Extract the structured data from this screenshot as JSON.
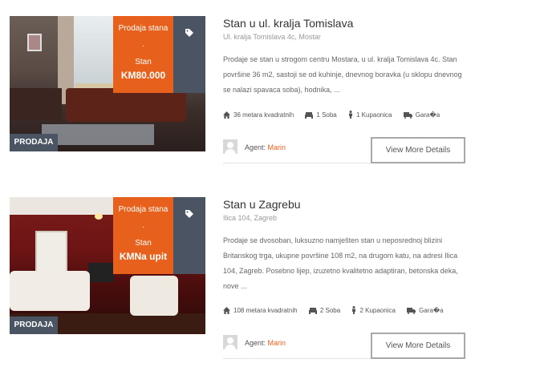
{
  "listings": [
    {
      "ribbon": {
        "type": "Prodaja stana",
        "dot": ".",
        "category": "Stan",
        "price": "KM80.000"
      },
      "status": "PRODAJA",
      "title": "Stan u ul. kralja Tomislava",
      "address": "Ul. kralja Tomislava 4c, Mostar",
      "description": "Prodaje se stan u strogom centru Mostara, u ul. kralja Tomislava 4c. Stan površine 36 m2, sastoji se od kuhinje, dnevnog boravka (u sklopu dnevnog se nalazi spavaca soba), hodnika, ...",
      "features": {
        "area": "36 metara kvadratnih",
        "rooms": "1 Soba",
        "baths": "1 Kupaonica",
        "garage": "Gara�a"
      },
      "agent_label": "Agent:",
      "agent_name": "Marin",
      "button": "View More Details"
    },
    {
      "ribbon": {
        "type": "Prodaja stana",
        "dot": ".",
        "category": "Stan",
        "price": "KMNa upit"
      },
      "status": "PRODAJA",
      "title": "Stan u Zagrebu",
      "address": "Ilica 104, Zagreb",
      "description": "Prodaje se dvosoban, luksuzno namješten stan u neposrednoj blizini Britanskog trga, ukupne površine 108 m2, na drugom katu, na adresi Ilica 104, Zagreb. Posebno lijep, izuzetno kvalitetno adaptiran, betonska deka, nove ...",
      "features": {
        "area": "108 metara kvadratnih",
        "rooms": "2 Soba",
        "baths": "2 Kupaonica",
        "garage": "Gara�a"
      },
      "agent_label": "Agent:",
      "agent_name": "Marin",
      "button": "View More Details"
    }
  ],
  "icons": {
    "tag": "tag-icon",
    "area": "home-icon",
    "rooms": "bed-icon",
    "baths": "person-icon",
    "garage": "truck-icon"
  },
  "colors": {
    "accent": "#e8611c",
    "slate": "#4a5462"
  }
}
